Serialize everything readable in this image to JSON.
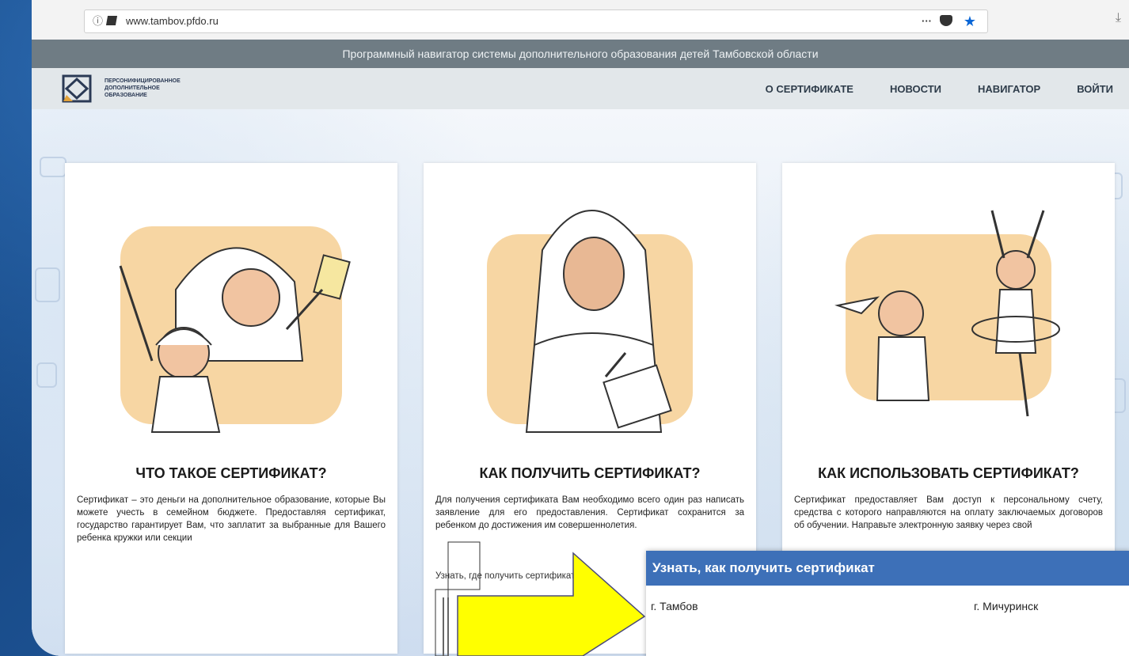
{
  "browser": {
    "url": "www.tambov.pfdo.ru",
    "more_label": "···"
  },
  "strip_text": "Программный навигатор системы дополнительного образования детей Тамбовской области",
  "logo": {
    "line1": "ПЕРСОНИФИЦИРОВАННОЕ",
    "line2": "ДОПОЛНИТЕЛЬНОЕ",
    "line3": "ОБРАЗОВАНИЕ"
  },
  "nav": {
    "items": [
      "О СЕРТИФИКАТЕ",
      "НОВОСТИ",
      "НАВИГАТОР",
      "ВОЙТИ"
    ]
  },
  "cards": [
    {
      "title": "ЧТО ТАКОЕ СЕРТИФИКАТ?",
      "body": "Сертификат – это деньги на дополнительное образование, которые Вы можете учесть в семейном бюджете. Предоставляя сертификат, государство гарантирует Вам, что заплатит за выбранные для Вашего ребенка кружки или секции"
    },
    {
      "title": "КАК ПОЛУЧИТЬ СЕРТИФИКАТ?",
      "body": "Для получения сертификата Вам необходимо всего один раз написать заявление для его предоставления. Сертификат сохранится за ребенком до достижения им совершеннолетия.",
      "link": "Узнать, где получить сертификат"
    },
    {
      "title": "КАК ИСПОЛЬЗОВАТЬ СЕРТИФИКАТ?",
      "body": "Сертификат предоставляет Вам доступ к персональному счету, средства с которого направляются на оплату заключаемых договоров об обучении. Направьте электронную заявку через свой"
    }
  ],
  "popup": {
    "title": "Узнать, как получить сертификат",
    "cities": [
      "г. Тамбов",
      "г. Мичуринск"
    ]
  },
  "colors": {
    "popup_header": "#3d70b8",
    "strip": "#6f7c84",
    "header": "#e2e7ea",
    "arrow": "#ffff00",
    "illus_bg": "#f7d6a3"
  }
}
